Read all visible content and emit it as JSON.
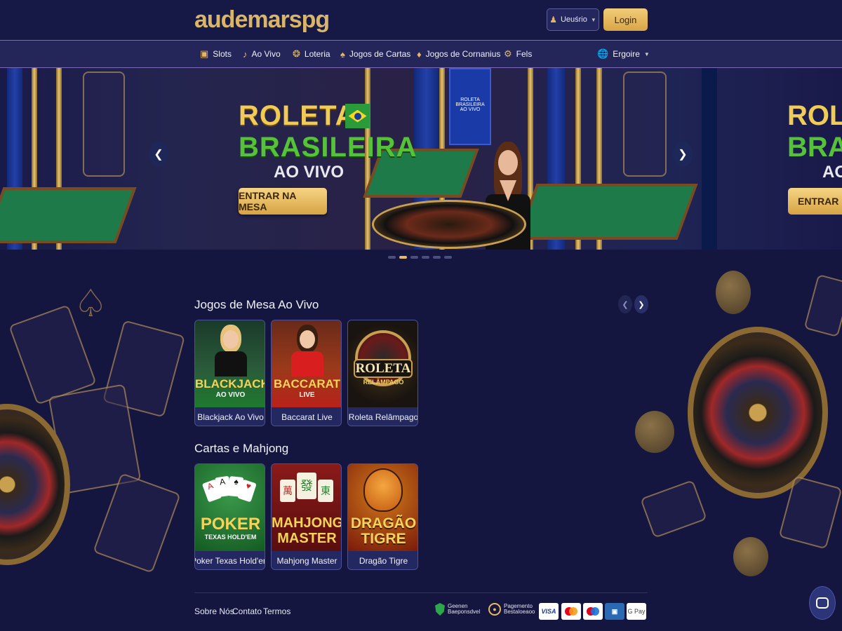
{
  "header": {
    "logo": "audemarspg",
    "user_label": "Ueuśrio",
    "login_label": "Login"
  },
  "nav": {
    "items": [
      {
        "label": "Slots",
        "icon": "slot-machine-icon"
      },
      {
        "label": "Ao Vivo",
        "icon": "money-bag-icon"
      },
      {
        "label": "Loteria",
        "icon": "lottery-ball-icon"
      },
      {
        "label": "Jogos de Cartas",
        "icon": "cards-icon"
      },
      {
        "label": "Jogos de Cornanius",
        "icon": "spade-icon"
      },
      {
        "label": "Fels",
        "icon": "joystick-icon"
      }
    ],
    "language_label": "Ergoire"
  },
  "hero": {
    "title_line1": "ROLETA",
    "title_line2": "BRASILEIRA",
    "title_line3": "AO VIVO",
    "cta_label": "ENTRAR NA MESA",
    "next_title_line1": "ROLETA",
    "next_title_line2": "BRASILEIRA",
    "next_title_line3": "AO",
    "next_cta_label": "ENTRAR NA MESA",
    "tv_text": "ROLETA BRASILEIRA",
    "tv_sub": "AO VIVO",
    "slide_count": 6,
    "active_slide": 2
  },
  "sections": [
    {
      "title": "Jogos de Mesa Ao Vivo",
      "games": [
        {
          "label": "Blackjack Ao Vivo",
          "art_main": "BLACKJACK",
          "art_sub": "AO VIVO"
        },
        {
          "label": "Baccarat Live",
          "art_main": "BACCARAT",
          "art_sub": "LIVE"
        },
        {
          "label": "Roleta Relâmpago",
          "art_main": "ROLETA",
          "art_sub": "RELÂMPAGO"
        }
      ]
    },
    {
      "title": "Cartas e Mahjong",
      "games": [
        {
          "label": "Poker Texas Hold'em",
          "art_main": "POKER",
          "art_sub": "TEXAS HOLD'EM"
        },
        {
          "label": "Mahjong Master",
          "art_main": "MAHJONG",
          "art_sub": "MASTER"
        },
        {
          "label": "Dragão Tigre",
          "art_main": "DRAGÃO",
          "art_sub": "TIGRE"
        }
      ]
    }
  ],
  "footer": {
    "links": [
      "Sobre Nós",
      "Contato",
      "Termos"
    ],
    "badge1_line1": "Geenen",
    "badge1_line2": "Baeponsdvel",
    "badge2_line1": "Pagemento",
    "badge2_line2": "Bestaloeaoo",
    "payments": [
      "VISA",
      "mastercard",
      "maestro",
      "card",
      "G Pay"
    ]
  },
  "colors": {
    "background": "#141640",
    "accent_gold": "#e8b862",
    "nav_bg": "#24265a"
  }
}
